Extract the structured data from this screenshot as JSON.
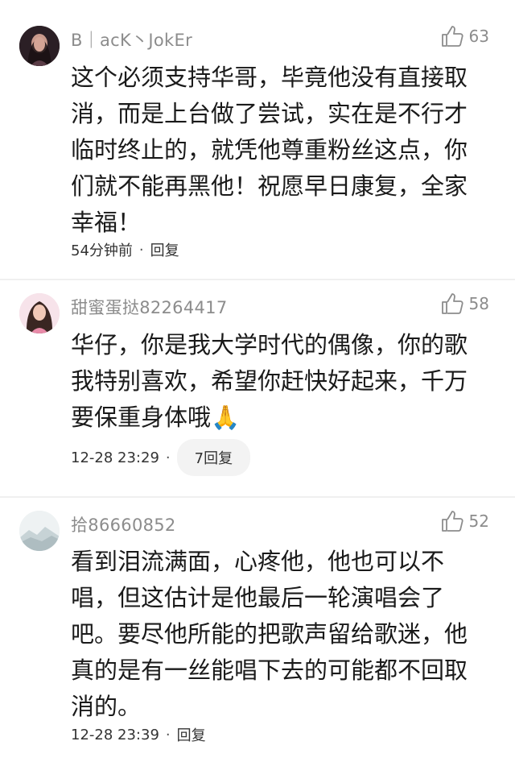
{
  "comments": [
    {
      "username": "B｜acK丶JokEr",
      "likes": "63",
      "text": "这个必须支持华哥，毕竟他没有直接取消，而是上台做了尝试，实在是不行才临时终止的，就凭他尊重粉丝这点，你们就不能再黑他！祝愿早日康复，全家幸福！",
      "time": "54分钟前",
      "reply": "回复",
      "avatar_icon": "avatar-dark-hair"
    },
    {
      "username": "甜蜜蛋挞82264417",
      "likes": "58",
      "text": "华仔，你是我大学时代的偶像，你的歌我特别喜欢，希望你赶快好起来，千万要保重身体哦🙏",
      "time": "12-28 23:29",
      "reply": "7回复",
      "avatar_icon": "avatar-girl-pink"
    },
    {
      "username": "拾86660852",
      "likes": "52",
      "text": "看到泪流满面，心疼他，他也可以不唱，但这估计是他最后一轮演唱会了吧。要尽他所能的把歌声留给歌迷，他真的是有一丝能唱下去的可能都不回取消的。",
      "time": "12-28 23:39",
      "reply": "回复",
      "avatar_icon": "avatar-landscape"
    }
  ],
  "colors": {
    "meta_gray": "#8c8c8c",
    "text": "#1a1a1a",
    "pill_bg": "#f3f3f3"
  }
}
